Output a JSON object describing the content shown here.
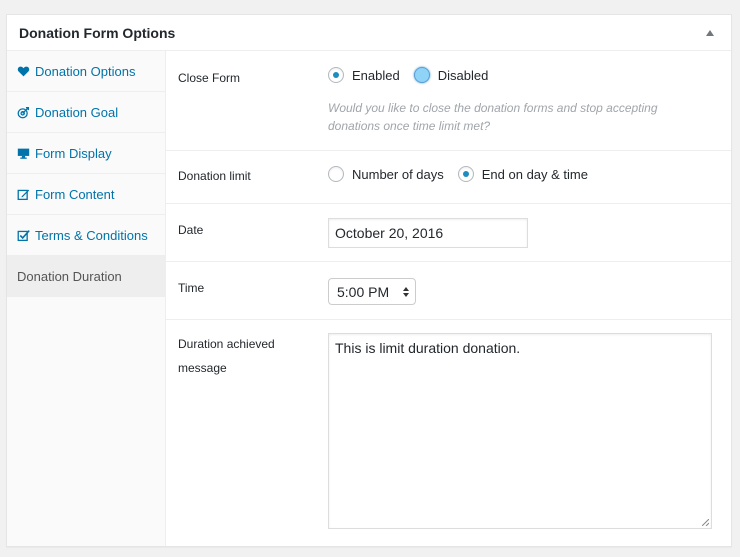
{
  "panel": {
    "title": "Donation Form Options"
  },
  "sidebar": {
    "tabs": [
      {
        "label": "Donation Options",
        "icon": "heart-icon"
      },
      {
        "label": "Donation Goal",
        "icon": "target-icon"
      },
      {
        "label": "Form Display",
        "icon": "monitor-icon"
      },
      {
        "label": "Form Content",
        "icon": "edit-icon"
      },
      {
        "label": "Terms & Conditions",
        "icon": "checkbox-icon"
      },
      {
        "label": "Donation Duration",
        "icon": ""
      }
    ],
    "active_index": 5
  },
  "close_form": {
    "label": "Close Form",
    "options": [
      "Enabled",
      "Disabled"
    ],
    "selected": "Enabled",
    "description": "Would you like to close the donation forms and stop accepting donations once time limit met?"
  },
  "donation_limit": {
    "label": "Donation limit",
    "options": [
      "Number of days",
      "End on day & time"
    ],
    "selected": "End on day & time"
  },
  "date": {
    "label": "Date",
    "value": "October 20, 2016"
  },
  "time": {
    "label": "Time",
    "value": "5:00 PM"
  },
  "duration_message": {
    "label_line1": "Duration achieved",
    "label_line2": "message",
    "value": "This is limit duration donation."
  },
  "colors": {
    "link": "#0073aa",
    "radio_checked": "#1e8cbe",
    "description": "#a0a5aa"
  }
}
